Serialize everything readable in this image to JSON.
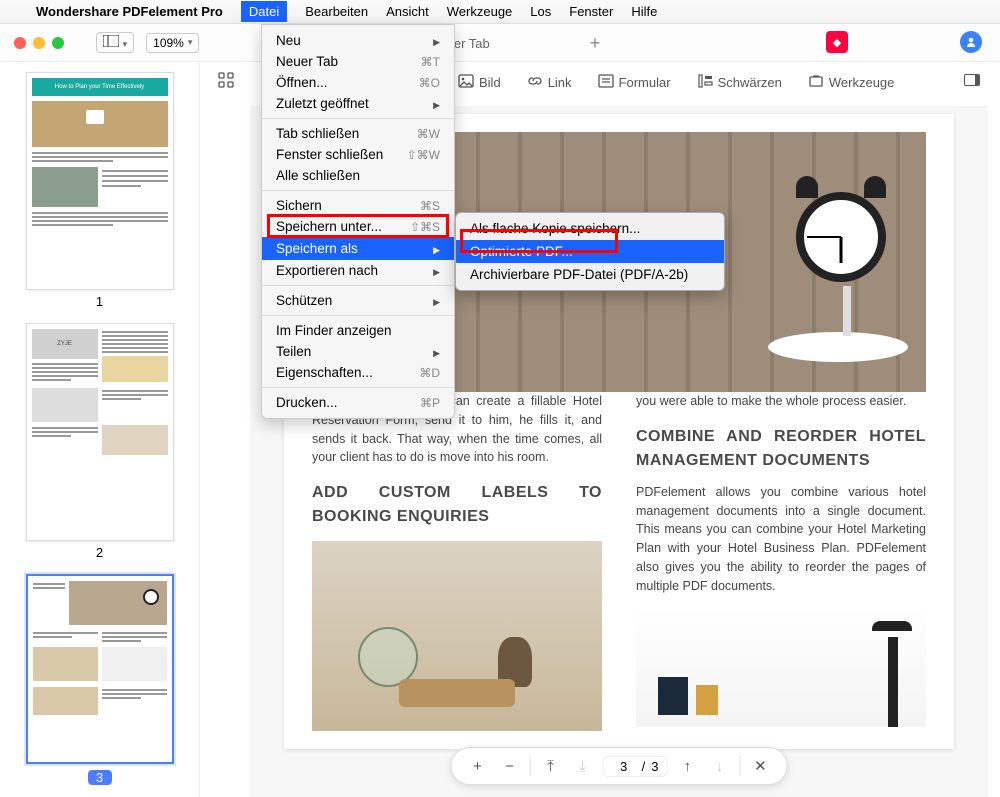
{
  "menubar": {
    "app_title": "Wondershare PDFelement Pro",
    "items": [
      "Datei",
      "Bearbeiten",
      "Ansicht",
      "Werkzeuge",
      "Los",
      "Fenster",
      "Hilfe"
    ],
    "active": "Datei"
  },
  "window": {
    "zoom": "109%",
    "new_tab": "Neuer Tab"
  },
  "sub_toolbar": {
    "items": [
      {
        "icon": "image-icon",
        "label": "Bild"
      },
      {
        "icon": "link-icon",
        "label": "Link"
      },
      {
        "icon": "form-icon",
        "label": "Formular"
      },
      {
        "icon": "redact-icon",
        "label": "Schwärzen"
      },
      {
        "icon": "tools-icon",
        "label": "Werkzeuge"
      }
    ]
  },
  "dropdown": {
    "groups": [
      [
        {
          "label": "Neu",
          "arrow": true
        },
        {
          "label": "Neuer Tab",
          "sc": "⌘T"
        },
        {
          "label": "Öffnen...",
          "sc": "⌘O"
        },
        {
          "label": "Zuletzt geöffnet",
          "arrow": true
        }
      ],
      [
        {
          "label": "Tab schließen",
          "sc": "⌘W"
        },
        {
          "label": "Fenster schließen",
          "sc": "⇧⌘W"
        },
        {
          "label": "Alle schließen"
        }
      ],
      [
        {
          "label": "Sichern",
          "sc": "⌘S"
        },
        {
          "label": "Speichern unter...",
          "sc": "⇧⌘S"
        },
        {
          "label": "Speichern als",
          "arrow": true,
          "highlight": true
        },
        {
          "label": "Exportieren nach",
          "arrow": true
        }
      ],
      [
        {
          "label": "Schützen",
          "arrow": true
        }
      ],
      [
        {
          "label": "Im Finder anzeigen"
        },
        {
          "label": "Teilen",
          "arrow": true
        },
        {
          "label": "Eigenschaften...",
          "sc": "⌘D"
        }
      ],
      [
        {
          "label": "Drucken...",
          "sc": "⌘P"
        }
      ]
    ]
  },
  "submenu": {
    "items": [
      {
        "label": "Als flache Kopie speichern..."
      },
      {
        "label": "Optimierte PDF...",
        "highlight": true
      },
      {
        "label": "Archivierbare PDF-Datei (PDF/A-2b)"
      }
    ]
  },
  "thumbnails": {
    "t1_banner": "How to Plan your Time Effectively",
    "labels": [
      "1",
      "2",
      "3"
    ],
    "active": 3
  },
  "document": {
    "left_para1": "With PDFelement, you can create a fillable Hotel Reservation Form, send it to him, he fills it, and sends it back. That way, when the time comes, all your client has to do is move into his room.",
    "left_h": "ADD CUSTOM LABELS TO BOOKING ENQUIRIES",
    "right_para1": "you were able to make the whole process easier.",
    "right_h": "COMBINE AND REORDER HOTEL MANAGEMENT DOCUMENTS",
    "right_para2": "PDFelement allows you combine various hotel management documents into a single document. This means you can combine your Hotel Marketing Plan with your Hotel Business Plan. PDFelement also gives you the ability to reorder the pages of multiple PDF documents."
  },
  "bottom": {
    "current_page": "3",
    "total_pages": "3"
  }
}
